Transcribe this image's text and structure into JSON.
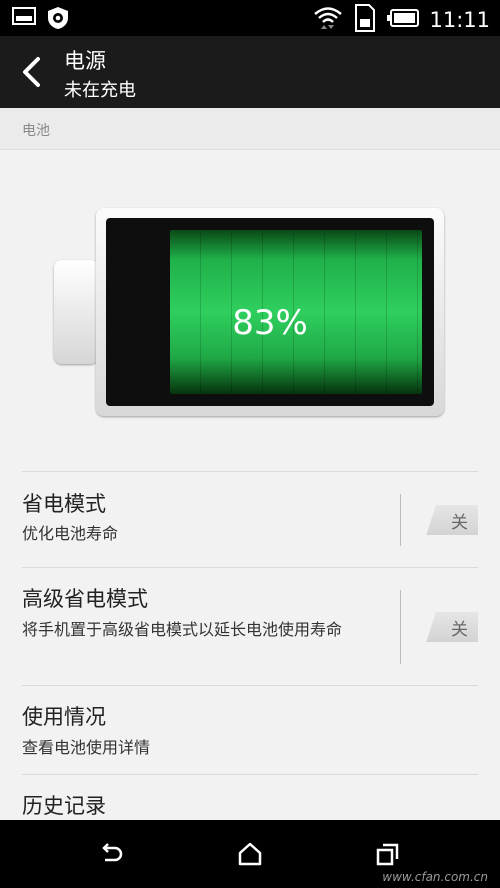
{
  "status_bar": {
    "time": "11:11"
  },
  "action_bar": {
    "title": "电源",
    "subtitle": "未在充电"
  },
  "section_header": "电池",
  "battery": {
    "level": 0.83,
    "percent_text": "83%"
  },
  "settings": [
    {
      "title": "省电模式",
      "subtitle": "优化电池寿命",
      "toggle": "关"
    },
    {
      "title": "高级省电模式",
      "subtitle": "将手机置于高级省电模式以延长电池使用寿命",
      "toggle": "关"
    },
    {
      "title": "使用情况",
      "subtitle": "查看电池使用详情"
    },
    {
      "title": "历史记录"
    }
  ],
  "watermark": "www.cfan.com.cn",
  "colors": {
    "battery_green": "#2fcf5e",
    "action_bar": "#1b1b1b"
  }
}
